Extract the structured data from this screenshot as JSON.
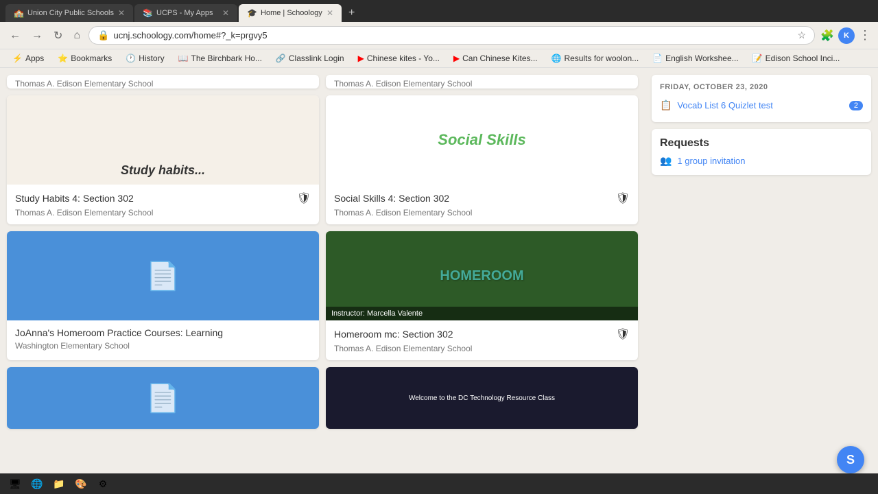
{
  "browser": {
    "tabs": [
      {
        "id": "tab1",
        "title": "Union City Public Schools",
        "favicon": "🏫",
        "active": false,
        "url": ""
      },
      {
        "id": "tab2",
        "title": "UCPS - My Apps",
        "favicon": "📚",
        "active": false,
        "url": ""
      },
      {
        "id": "tab3",
        "title": "Home | Schoology",
        "favicon": "🎓",
        "active": true,
        "url": "ucnj.schoology.com/home#?_k=prgvy5"
      }
    ],
    "new_tab_label": "+",
    "address": "ucnj.schoology.com/home#?_k=prgvy5"
  },
  "bookmarks": [
    {
      "id": "bm1",
      "label": "Apps",
      "icon": "⚡"
    },
    {
      "id": "bm2",
      "label": "Bookmarks",
      "icon": "⭐"
    },
    {
      "id": "bm3",
      "label": "History",
      "icon": "🕐"
    },
    {
      "id": "bm4",
      "label": "The Birchbark Ho...",
      "icon": "📖"
    },
    {
      "id": "bm5",
      "label": "Classlink Login",
      "icon": "🔗"
    },
    {
      "id": "bm6",
      "label": "Chinese kites - Yo...",
      "icon": "▶"
    },
    {
      "id": "bm7",
      "label": "Can Chinese Kites...",
      "icon": "▶"
    },
    {
      "id": "bm8",
      "label": "Results for woolon...",
      "icon": "🌐"
    },
    {
      "id": "bm9",
      "label": "English Workshee...",
      "icon": "📄"
    },
    {
      "id": "bm10",
      "label": "Edison School Inci...",
      "icon": "📝"
    }
  ],
  "cards": {
    "left_column": [
      {
        "id": "card-study",
        "school_top": "Thomas A. Edison Elementary School",
        "title": "Study Habits 4: Section 302",
        "school_bottom": "Thomas A. Edison Elementary School",
        "has_shield": true,
        "image_type": "study"
      },
      {
        "id": "card-joanna",
        "school_top": "",
        "title": "JoAnna's Homeroom Practice Courses: Learning",
        "school_bottom": "Washington Elementary School",
        "has_shield": false,
        "image_type": "blue-doc"
      },
      {
        "id": "card-partial-left",
        "school_top": "",
        "title": "",
        "school_bottom": "",
        "has_shield": false,
        "image_type": "blue-doc-partial"
      }
    ],
    "right_column": [
      {
        "id": "card-social",
        "school_top": "Thomas A. Edison Elementary School",
        "title": "Social Skills 4: Section 302",
        "school_bottom": "Thomas A. Edison Elementary School",
        "has_shield": true,
        "image_type": "social"
      },
      {
        "id": "card-homeroom",
        "school_top": "",
        "title": "Homeroom mc: Section 302",
        "school_bottom": "Thomas A. Edison Elementary School",
        "has_shield": true,
        "image_type": "homeroom",
        "instructor": "Instructor: Marcella Valente"
      },
      {
        "id": "card-tech",
        "school_top": "",
        "title": "",
        "school_bottom": "",
        "has_shield": false,
        "image_type": "tech-partial"
      }
    ]
  },
  "sidebar": {
    "date": "FRIDAY, OCTOBER 23, 2020",
    "assignments": [
      {
        "id": "assign1",
        "title": "Vocab List 6 Quizlet test",
        "badge": "2",
        "icon": "📋"
      }
    ],
    "requests_label": "Requests",
    "requests": [
      {
        "id": "req1",
        "text": "1 group invitation",
        "icon": "👥"
      }
    ]
  },
  "user": {
    "avatar_letter": "S",
    "avatar_color": "#4285f4"
  },
  "taskbar": {
    "icons": [
      "🖥",
      "🌐",
      "📁",
      "🎨",
      "⚙"
    ]
  }
}
